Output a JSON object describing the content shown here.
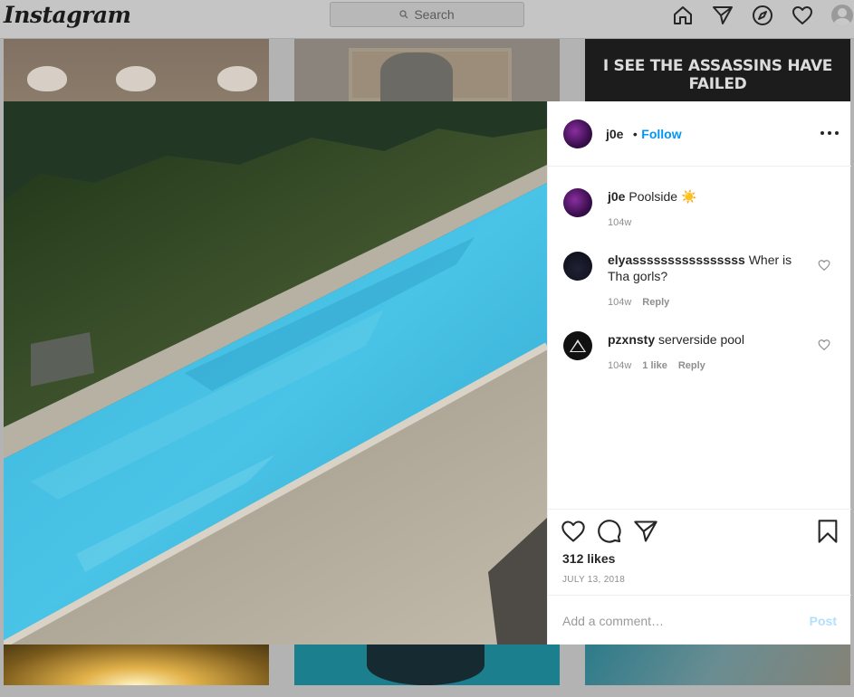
{
  "nav": {
    "logo": "Instagram",
    "search_placeholder": "Search",
    "icons": [
      "home-icon",
      "direct-icon",
      "explore-icon",
      "activity-heart-icon",
      "profile-avatar"
    ]
  },
  "background": {
    "meme_text": "I SEE THE ASSASSINS HAVE FAILED"
  },
  "post": {
    "username": "j0e",
    "follow_separator": "•",
    "follow_label": "Follow",
    "caption": {
      "username": "j0e",
      "text": "Poolside ☀️",
      "age": "104w"
    },
    "comments": [
      {
        "username": "elyassssssssssssssss",
        "text": "Wher is Tha gorls?",
        "age": "104w",
        "likes": "",
        "reply": "Reply"
      },
      {
        "username": "pzxnsty",
        "text": "serverside pool",
        "age": "104w",
        "likes": "1 like",
        "reply": "Reply"
      }
    ],
    "likes": "312 likes",
    "date": "JULY 13, 2018",
    "add_comment_placeholder": "Add a comment…",
    "post_label": "Post"
  },
  "colors": {
    "accent_blue": "#0095f6",
    "post_disabled": "#b2dffc",
    "pool_water": "#3cb3d8"
  }
}
